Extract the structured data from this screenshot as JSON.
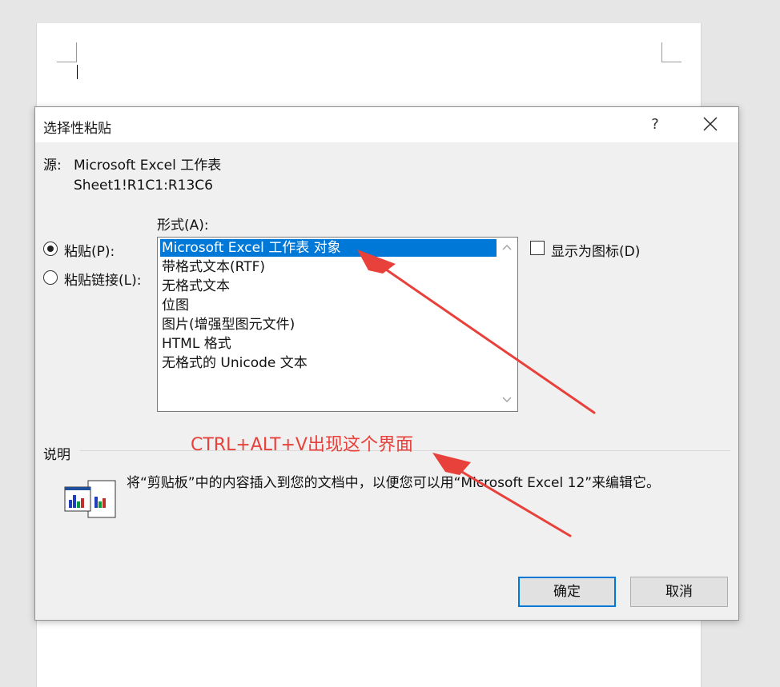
{
  "dialog": {
    "title": "选择性粘贴",
    "help": "?",
    "source_label": "源:",
    "source_value": "Microsoft Excel 工作表",
    "source_range": "Sheet1!R1C1:R13C6",
    "format_label": "形式(A):",
    "radio_paste_label": "粘贴(P):",
    "radio_paste_link_label": "粘贴链接(L):",
    "radio_selected": "粘贴(P):",
    "format_items": [
      "Microsoft Excel 工作表 对象",
      "带格式文本(RTF)",
      "无格式文本",
      "位图",
      "图片(增强型图元文件)",
      "HTML 格式",
      "无格式的 Unicode 文本"
    ],
    "selected_format": "Microsoft Excel 工作表 对象",
    "display_as_icon_label": "显示为图标(D)",
    "display_as_icon_checked": false,
    "description_label": "说明",
    "description_text": "将“剪贴板”中的内容插入到您的文档中，以便您可以用“Microsoft Excel 12”来编辑它。",
    "ok_label": "确定",
    "cancel_label": "取消"
  },
  "annotation": {
    "text": "CTRL+ALT+V出现这个界面",
    "color": "#e8403a"
  },
  "colors": {
    "selection": "#0078d7",
    "dialog_bg": "#f0f0f0",
    "canvas_bg": "#e6e6e6"
  }
}
